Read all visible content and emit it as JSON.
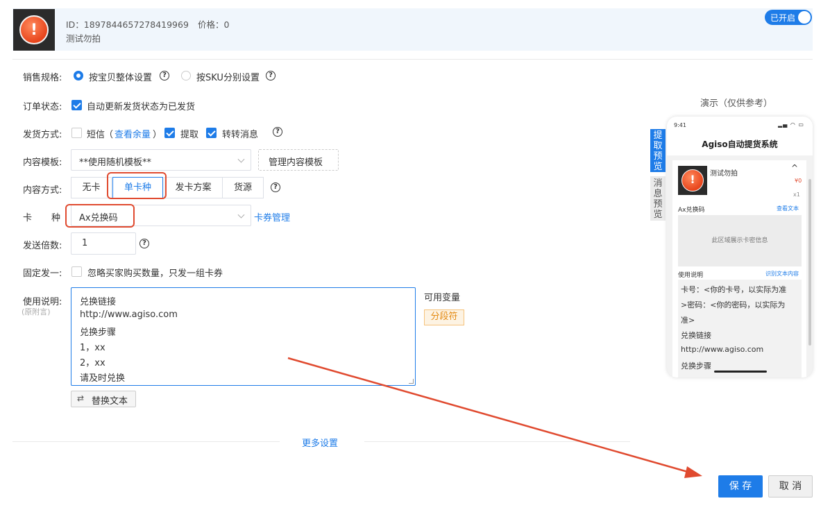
{
  "header": {
    "product_id": "ID：1897844657278419969",
    "price": "价格：0",
    "product_name": "测试勿拍",
    "toggle_label": "已开启"
  },
  "form": {
    "sales_spec": {
      "label": "销售规格:",
      "option1": "按宝贝整体设置",
      "option2": "按SKU分别设置",
      "selected": "option1"
    },
    "order_status": {
      "label": "订单状态:",
      "checkbox_label": "自动更新发货状态为已发货",
      "checked": true
    },
    "delivery": {
      "label": "发货方式:",
      "sms": "短信",
      "sms_paren_open": "（",
      "sms_link": "查看余量",
      "sms_paren_close": "）",
      "pickup": "提取",
      "forward": "转转消息"
    },
    "template": {
      "label": "内容模板:",
      "value": "**使用随机模板**",
      "manage_button": "管理内容模板"
    },
    "content_mode": {
      "label": "内容方式:",
      "options": [
        "无卡",
        "单卡种",
        "发卡方案",
        "货源"
      ],
      "selected_index": 1
    },
    "card_type": {
      "label_a": "卡",
      "label_b": "种",
      "value": "Ax兑换码",
      "manage_link": "卡券管理"
    },
    "multiplier": {
      "label": "发送倍数:",
      "value": "1"
    },
    "fixed_one": {
      "label": "固定发一:",
      "checkbox_label": "忽略买家购买数量，只发一组卡券",
      "checked": false
    },
    "instructions": {
      "label": "使用说明:",
      "sublabel": "(原附言)",
      "lines": [
        "兑换链接",
        "http://www.agiso.com",
        "兑换步骤",
        "1，xx",
        "2，xx",
        "请及时兑换"
      ],
      "vars_label": "可用变量",
      "var_tag": "分段符",
      "replace_button": "替换文本"
    },
    "more_settings": "更多设置"
  },
  "preview": {
    "caption": "演示（仅供参考）",
    "tab_pickup": "提取预览",
    "tab_message": "消息预览",
    "time": "9:41",
    "app_title": "Agiso自动提货系统",
    "product_name": "测试勿拍",
    "price": "¥0",
    "qty": "x1",
    "card_name": "Ax兑换码",
    "view_text": "查看文本",
    "card_area": "此区域展示卡密信息",
    "instructions_title": "使用说明",
    "copy_text": "识别文本内容",
    "content_lines": [
      "卡号：<你的卡号，以实际为准",
      ">密码：<你的密码，以实际为",
      "准>",
      "兑换链接",
      "http://www.agiso.com",
      "兑换步骤"
    ]
  },
  "actions": {
    "save": "保 存",
    "cancel": "取 消"
  },
  "colors": {
    "primary": "#1e7ce8",
    "annotation_red": "#e04a2f",
    "tag_orange": "#e48a12"
  }
}
